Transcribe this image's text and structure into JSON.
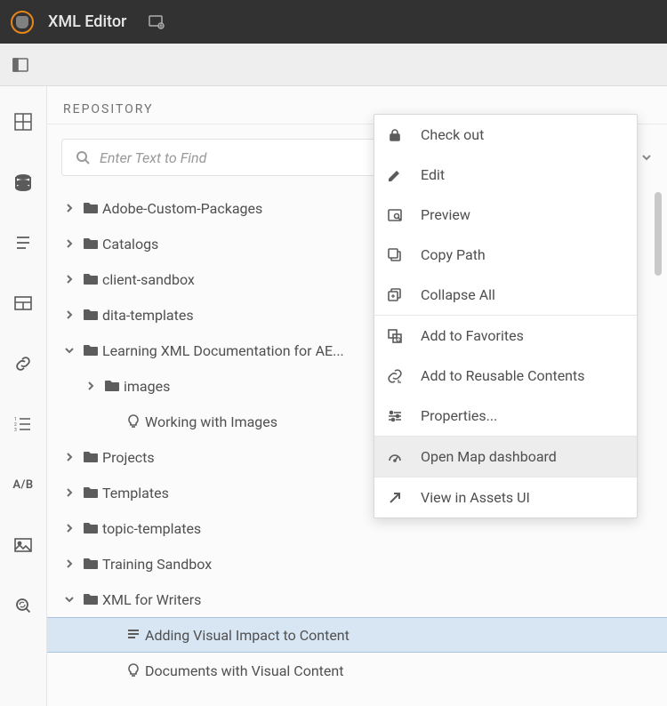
{
  "header": {
    "title": "XML Editor"
  },
  "panel": {
    "title": "REPOSITORY",
    "search_placeholder": "Enter Text to Find"
  },
  "iconrail_text": "A/B",
  "tree": [
    {
      "depth": 0,
      "toggle": "right",
      "icon": "folder",
      "label": "Adobe-Custom-Packages"
    },
    {
      "depth": 0,
      "toggle": "right",
      "icon": "folder",
      "label": "Catalogs"
    },
    {
      "depth": 0,
      "toggle": "right",
      "icon": "folder",
      "label": "client-sandbox"
    },
    {
      "depth": 0,
      "toggle": "right",
      "icon": "folder",
      "label": "dita-templates"
    },
    {
      "depth": 0,
      "toggle": "down",
      "icon": "folder",
      "label": "Learning XML Documentation for AE..."
    },
    {
      "depth": 1,
      "toggle": "right",
      "icon": "folder",
      "label": "images"
    },
    {
      "depth": 2,
      "toggle": "",
      "icon": "bulb",
      "label": "Working with Images"
    },
    {
      "depth": 0,
      "toggle": "right",
      "icon": "folder",
      "label": "Projects"
    },
    {
      "depth": 0,
      "toggle": "right",
      "icon": "folder",
      "label": "Templates"
    },
    {
      "depth": 0,
      "toggle": "right",
      "icon": "folder",
      "label": "topic-templates"
    },
    {
      "depth": 0,
      "toggle": "right",
      "icon": "folder",
      "label": "Training Sandbox"
    },
    {
      "depth": 0,
      "toggle": "down",
      "icon": "folder",
      "label": "XML for Writers"
    },
    {
      "depth": 2,
      "toggle": "",
      "icon": "map",
      "label": "Adding Visual Impact to Content",
      "selected": true
    },
    {
      "depth": 2,
      "toggle": "",
      "icon": "bulb",
      "label": "Documents with Visual Content"
    }
  ],
  "context_menu": [
    {
      "icon": "lock",
      "label": "Check out"
    },
    {
      "icon": "pencil",
      "label": "Edit"
    },
    {
      "icon": "preview",
      "label": "Preview"
    },
    {
      "icon": "copy",
      "label": "Copy Path"
    },
    {
      "icon": "collapse",
      "label": "Collapse All"
    },
    {
      "sep": true
    },
    {
      "icon": "favorite",
      "label": "Add to Favorites"
    },
    {
      "icon": "reuse",
      "label": "Add to Reusable Contents"
    },
    {
      "icon": "settings",
      "label": "Properties..."
    },
    {
      "sep": true
    },
    {
      "icon": "gauge",
      "label": "Open Map dashboard",
      "hovered": true
    },
    {
      "sep": true
    },
    {
      "icon": "arrow",
      "label": "View in Assets UI"
    }
  ]
}
